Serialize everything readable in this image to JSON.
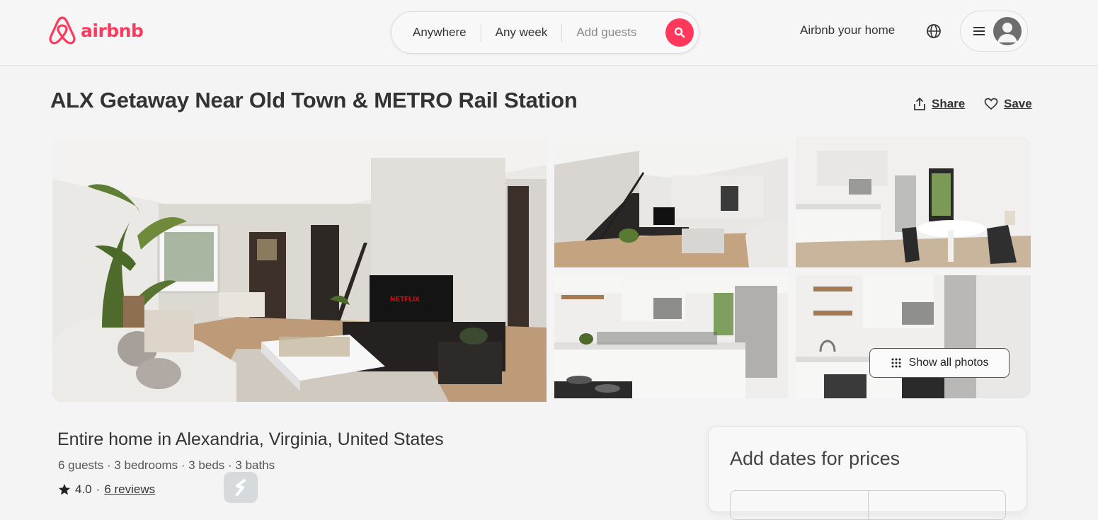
{
  "brand": {
    "name": "airbnb",
    "color": "#ff385c"
  },
  "search": {
    "location": "Anywhere",
    "dates": "Any week",
    "guests_placeholder": "Add guests"
  },
  "header": {
    "host_link": "Airbnb your home"
  },
  "listing": {
    "title": "ALX Getaway Near Old Town & METRO Rail Station",
    "share_label": "Share",
    "save_label": "Save",
    "show_all_photos": "Show all photos",
    "tv_brand": "NETFLIX",
    "subtitle": "Entire home in Alexandria, Virginia, United States",
    "details": "6 guests · 3 bedrooms · 3 beds · 3 baths",
    "rating": "4.0",
    "rating_sep": "·",
    "reviews": "6 reviews"
  },
  "booking": {
    "title": "Add dates for prices"
  },
  "icons": [
    "airbnb-logo-icon",
    "search-icon",
    "globe-icon",
    "menu-icon",
    "avatar-icon",
    "share-icon",
    "heart-icon",
    "grid-icon",
    "star-icon",
    "s-app-icon"
  ]
}
